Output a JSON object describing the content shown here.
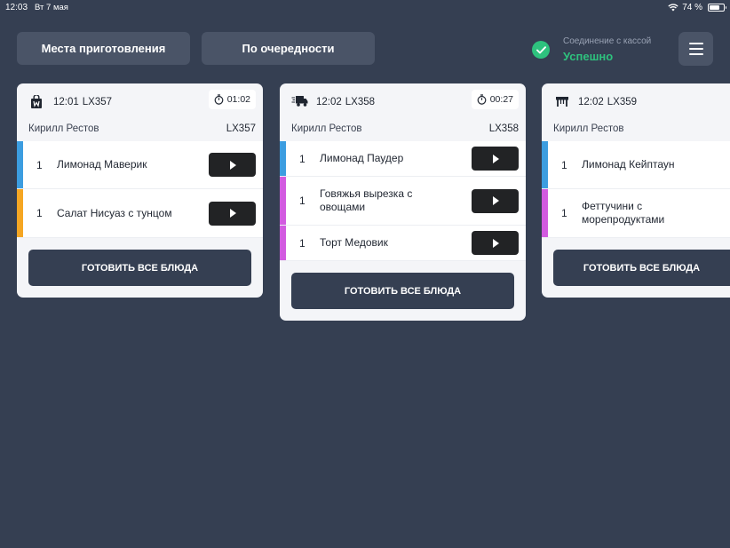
{
  "status_bar": {
    "time": "12:03",
    "date": "Вт 7 мая",
    "battery": "74 %",
    "battery_level": 0.74
  },
  "toolbar": {
    "places_label": "Места приготовления",
    "queue_label": "По очередности",
    "connection_label": "Соединение с кассой",
    "connection_status": "Успешно"
  },
  "colors": {
    "background": "#353f52",
    "accent_success": "#2ec27e",
    "stripe_blue": "#3c9de0",
    "stripe_orange": "#f5a623",
    "stripe_magenta": "#d25ae0"
  },
  "orders": [
    {
      "type_icon": "bag-icon",
      "time": "12:01",
      "code": "LX357",
      "timer": "01:02",
      "customer": "Кирилл Рестов",
      "order_code": "LX357",
      "items": [
        {
          "qty": "1",
          "name": "Лимонад Маверик",
          "stripe": "#3c9de0"
        },
        {
          "qty": "1",
          "name": "Салат Нисуаз с тунцом",
          "stripe": "#f5a623"
        }
      ],
      "cook_all_label": "ГОТОВИТЬ ВСЕ БЛЮДА"
    },
    {
      "type_icon": "delivery-truck-icon",
      "time": "12:02",
      "code": "LX358",
      "timer": "00:27",
      "customer": "Кирилл Рестов",
      "order_code": "LX358",
      "items": [
        {
          "qty": "1",
          "name": "Лимонад Паудер",
          "stripe": "#3c9de0"
        },
        {
          "qty": "1",
          "name": "Говяжья вырезка с овощами",
          "stripe": "#d25ae0"
        },
        {
          "qty": "1",
          "name": "Торт Медовик",
          "stripe": "#d25ae0"
        }
      ],
      "cook_all_label": "ГОТОВИТЬ ВСЕ БЛЮДА"
    },
    {
      "type_icon": "table-icon",
      "time": "12:02",
      "code": "LX359",
      "customer": "Кирилл Рестов",
      "items": [
        {
          "qty": "1",
          "name": "Лимонад Кейптаун",
          "stripe": "#3c9de0"
        },
        {
          "qty": "1",
          "name": "Феттучини с морепродуктами",
          "stripe": "#d25ae0"
        }
      ],
      "cook_all_label": "ГОТОВИТЬ ВСЕ БЛЮДА"
    }
  ]
}
